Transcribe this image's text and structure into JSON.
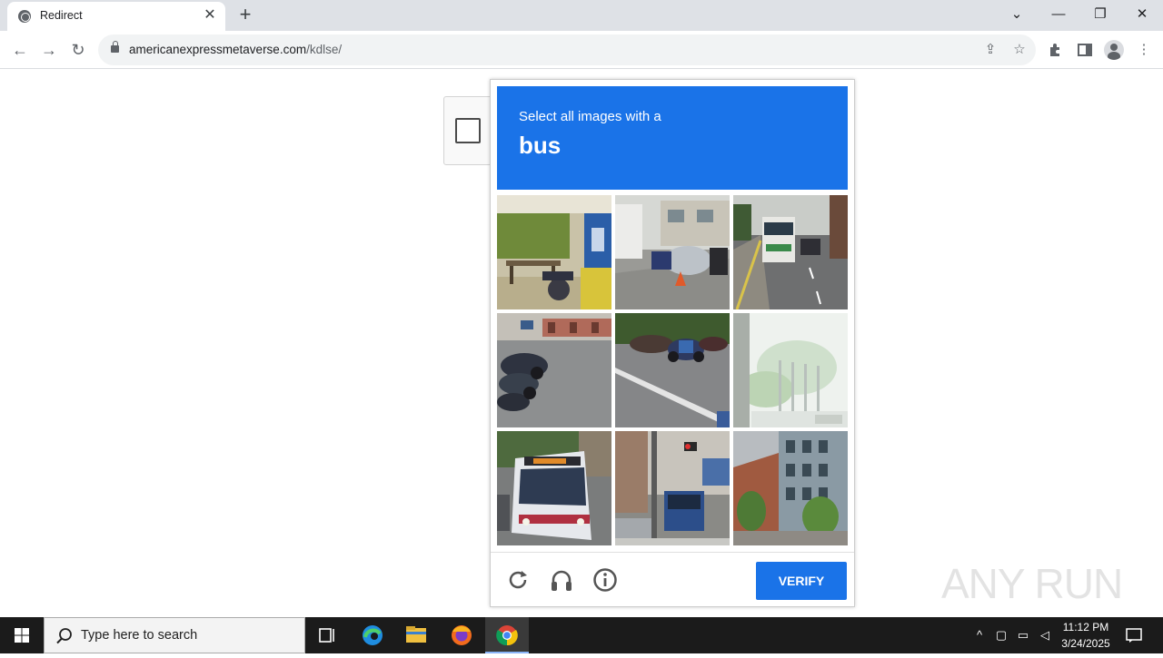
{
  "browser": {
    "tab_title": "Redirect",
    "tab_close_icon": "close-icon",
    "new_tab_icon": "plus-icon",
    "url_domain": "americanexpressmetaverse.com",
    "url_path": "/kdlse/"
  },
  "challenge": {
    "prompt_line1": "Select all images with a",
    "prompt_line2": "bus",
    "accent_color": "#1a73e8",
    "tiles": [
      "bench-and-ticket-machine",
      "street-with-covered-scooter",
      "highway-with-bus",
      "parked-motorcycles",
      "motorcycles-on-road",
      "street-lamps-and-trees",
      "city-bus-front",
      "street-with-bus-and-traffic-light",
      "apartment-buildings"
    ],
    "verify_label": "VERIFY",
    "footer_icons": [
      "refresh-icon",
      "headphones-icon",
      "info-icon"
    ]
  },
  "watermark": {
    "text": "ANY RUN"
  },
  "taskbar": {
    "search_placeholder": "Type here to search",
    "time": "11:12 PM",
    "date": "3/24/2025"
  }
}
